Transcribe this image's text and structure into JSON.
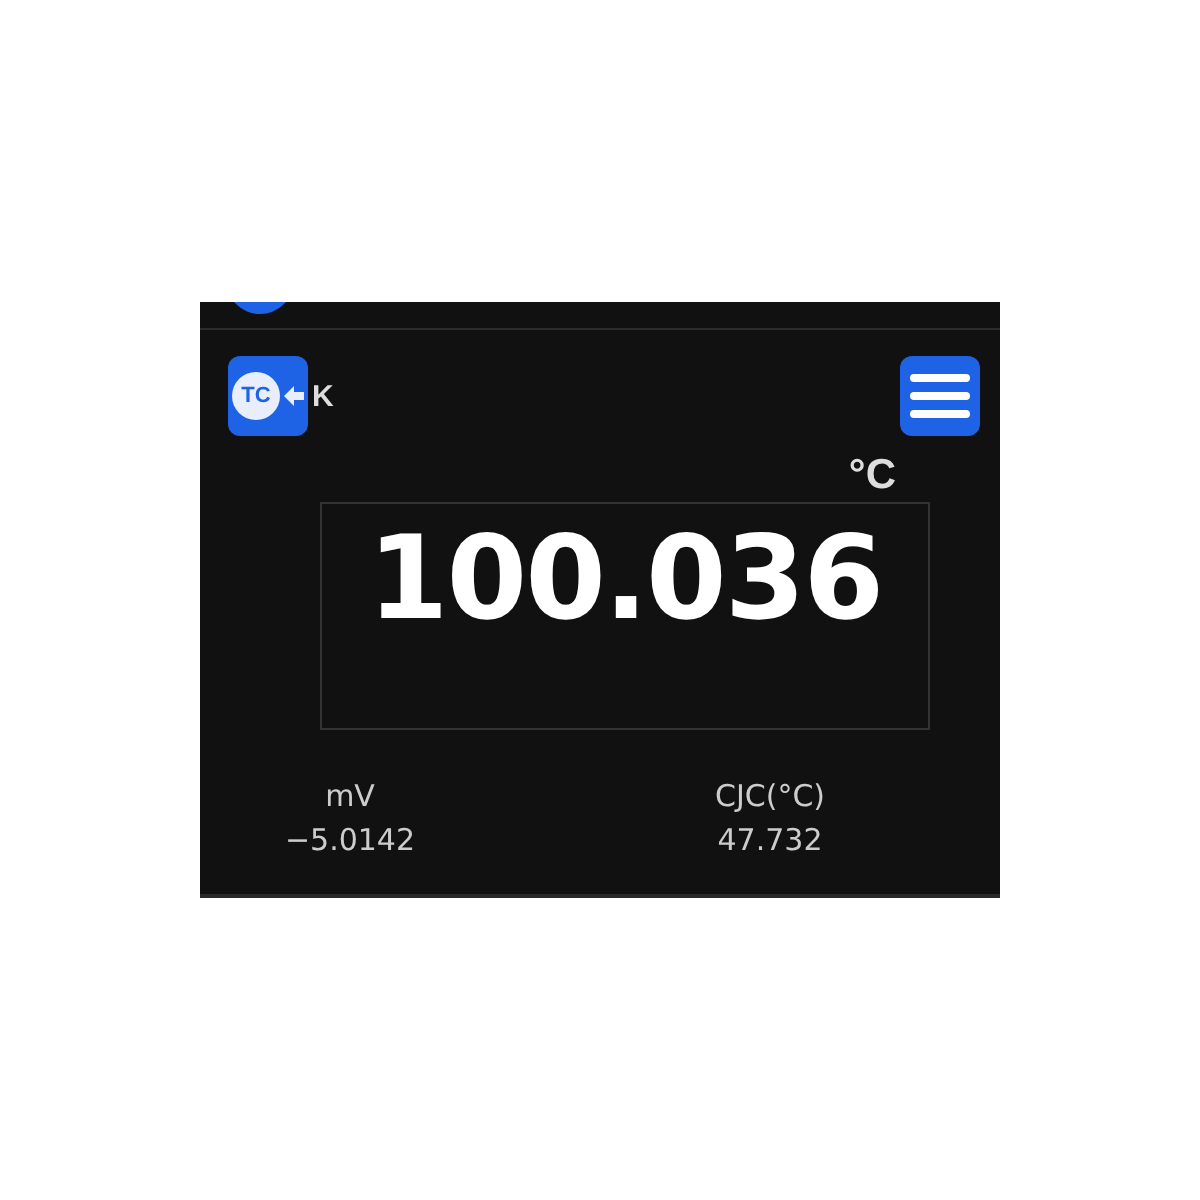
{
  "sensor": {
    "icon_label": "TC",
    "type": "K"
  },
  "unit": "°C",
  "reading": "100.036",
  "readouts": [
    {
      "label": "mV",
      "value": "−5.0142"
    },
    {
      "label": "CJC(°C)",
      "value": "47.732"
    }
  ]
}
